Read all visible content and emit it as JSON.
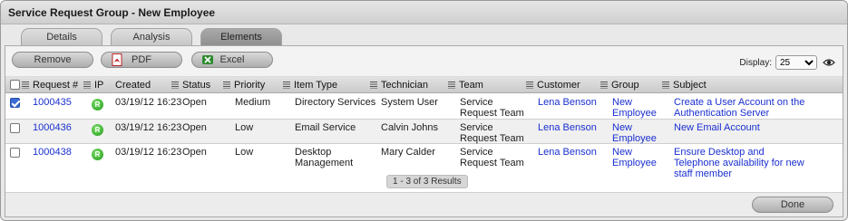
{
  "window": {
    "title": "Service Request Group - New Employee"
  },
  "tabs": [
    {
      "label": "Details"
    },
    {
      "label": "Analysis"
    },
    {
      "label": "Elements"
    }
  ],
  "toolbar": {
    "remove_label": "Remove",
    "pdf_label": "PDF",
    "excel_label": "Excel",
    "display_label": "Display:",
    "display_value": "25"
  },
  "table": {
    "headers": [
      "Request #",
      "IP",
      "Created",
      "Status",
      "Priority",
      "Item Type",
      "Technician",
      "Team",
      "Customer",
      "Group",
      "Subject"
    ],
    "rows": [
      {
        "checked": true,
        "request": "1000435",
        "ip": "R",
        "created": "03/19/12 16:23",
        "status": "Open",
        "priority": "Medium",
        "item_type": "Directory Services",
        "technician": "System User",
        "team": "Service Request Team",
        "customer": "Lena Benson",
        "group": "New Employee",
        "subject": "Create a User Account on the Authentication Server"
      },
      {
        "checked": false,
        "request": "1000436",
        "ip": "R",
        "created": "03/19/12 16:23",
        "status": "Open",
        "priority": "Low",
        "item_type": "Email Service",
        "technician": "Calvin Johns",
        "team": "Service Request Team",
        "customer": "Lena Benson",
        "group": "New Employee",
        "subject": "New Email Account"
      },
      {
        "checked": false,
        "request": "1000438",
        "ip": "R",
        "created": "03/19/12 16:23",
        "status": "Open",
        "priority": "Low",
        "item_type": "Desktop Management",
        "technician": "Mary Calder",
        "team": "Service Request Team",
        "customer": "Lena Benson",
        "group": "New Employee",
        "subject": "Ensure Desktop and Telephone availability for new staff member"
      }
    ]
  },
  "pager": {
    "text": "1 - 3 of 3 Results"
  },
  "footer": {
    "done_label": "Done"
  },
  "icons": {
    "pdf": "pdf-icon",
    "excel": "excel-icon",
    "eye": "eye-icon",
    "ip": "ip-status-icon",
    "grip": "column-grip-icon"
  },
  "colors": {
    "link": "#1a2fcf",
    "ip_badge": "#1f9a17",
    "checkbox": "#3b6bd6"
  }
}
